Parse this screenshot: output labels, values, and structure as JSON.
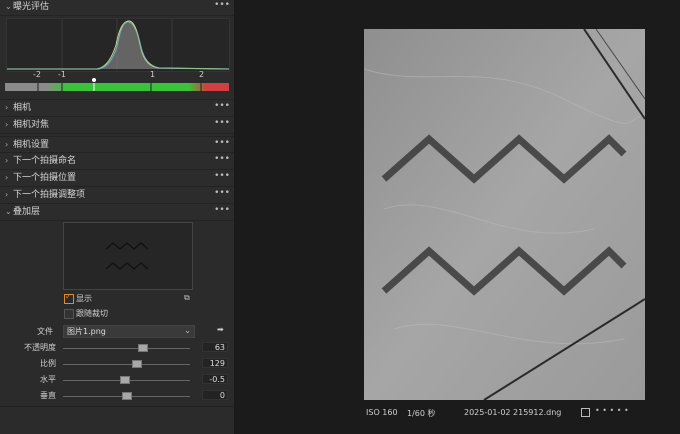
{
  "panels": [
    {
      "label": "曝光评估",
      "expanded": true
    },
    {
      "label": "相机",
      "expanded": false
    },
    {
      "label": "相机对焦",
      "expanded": false
    },
    {
      "label": "相机设置",
      "expanded": false
    },
    {
      "label": "下一个拍摄命名",
      "expanded": false
    },
    {
      "label": "下一个拍摄位置",
      "expanded": false
    },
    {
      "label": "下一个拍摄调整项",
      "expanded": false
    },
    {
      "label": "叠加层",
      "expanded": true
    }
  ],
  "exposure": {
    "ticks": [
      "-2",
      "-1",
      "1",
      "2"
    ]
  },
  "overlay": {
    "show_label": "显示",
    "show_checked": true,
    "crop_label": "跟随裁切",
    "crop_checked": false,
    "file_label": "文件",
    "file_value": "图片1.png",
    "sliders": [
      {
        "label": "不透明度",
        "value": "63",
        "fraction": 0.63
      },
      {
        "label": "比例",
        "value": "129",
        "fraction": 0.58
      },
      {
        "label": "水平",
        "value": "-0.5",
        "fraction": 0.49
      },
      {
        "label": "垂直",
        "value": "0",
        "fraction": 0.5
      }
    ]
  },
  "status": {
    "iso": "ISO 160",
    "shutter": "1/60 秒",
    "filename": "2025-01-02 215912.dng"
  },
  "icons": {
    "more": "more-dots-icon",
    "expand": "chevron-down-icon",
    "collapse": "chevron-right-icon",
    "copy": "copy-icon",
    "arrow": "arrow-right-icon"
  }
}
